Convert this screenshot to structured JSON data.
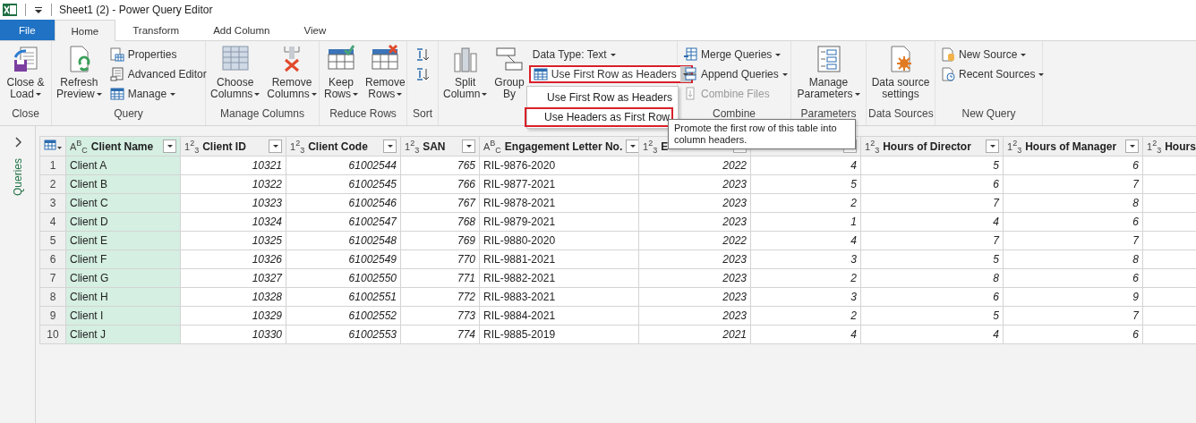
{
  "window": {
    "title": "Sheet1 (2) - Power Query Editor"
  },
  "tabs": [
    {
      "label": "File",
      "kind": "file",
      "selected": false
    },
    {
      "label": "Home",
      "kind": "tab",
      "selected": true
    },
    {
      "label": "Transform",
      "kind": "tab",
      "selected": false
    },
    {
      "label": "Add Column",
      "kind": "tab",
      "selected": false
    },
    {
      "label": "View",
      "kind": "tab",
      "selected": false
    }
  ],
  "ribbon": {
    "groups": [
      {
        "label": "Close",
        "items": [
          {
            "kind": "large",
            "lines": [
              "Close &",
              "Load"
            ],
            "dropdown": true
          }
        ]
      },
      {
        "label": "Query",
        "items": [
          {
            "kind": "large",
            "lines": [
              "Refresh",
              "Preview"
            ],
            "dropdown": true
          },
          {
            "kind": "stack",
            "items": [
              {
                "label": "Properties",
                "dropdown": false
              },
              {
                "label": "Advanced Editor",
                "dropdown": false
              },
              {
                "label": "Manage",
                "dropdown": true
              }
            ]
          }
        ]
      },
      {
        "label": "Manage Columns",
        "items": [
          {
            "kind": "large",
            "lines": [
              "Choose",
              "Columns"
            ],
            "dropdown": true
          },
          {
            "kind": "large",
            "lines": [
              "Remove",
              "Columns"
            ],
            "dropdown": true
          }
        ]
      },
      {
        "label": "Reduce Rows",
        "items": [
          {
            "kind": "large",
            "lines": [
              "Keep",
              "Rows"
            ],
            "dropdown": true
          },
          {
            "kind": "large",
            "lines": [
              "Remove",
              "Rows"
            ],
            "dropdown": true
          }
        ]
      },
      {
        "label": "Sort",
        "items": [
          {
            "kind": "icons",
            "items": [
              {
                "kind": "icon"
              },
              {
                "kind": "icon"
              }
            ]
          }
        ]
      },
      {
        "items": [
          {
            "kind": "large",
            "lines": [
              "Split",
              "Column"
            ],
            "dropdown": true
          },
          {
            "kind": "large",
            "lines": [
              "Group",
              "By"
            ],
            "dropdown": false
          },
          {
            "kind": "stack",
            "items": [
              {
                "label": "Data Type: Text",
                "dropdown": true
              },
              {
                "label": "Use First Row as Headers",
                "split": true,
                "highlighted": true
              }
            ]
          }
        ]
      },
      {
        "label": "Combine",
        "items": [
          {
            "kind": "stack",
            "items": [
              {
                "label": "Merge Queries",
                "dropdown": true
              },
              {
                "label": "Append Queries",
                "dropdown": true
              },
              {
                "label": "Combine Files",
                "disabled": true
              }
            ]
          }
        ]
      },
      {
        "label": "Parameters",
        "items": [
          {
            "kind": "large",
            "lines": [
              "Manage",
              "Parameters"
            ],
            "dropdown": true
          }
        ]
      },
      {
        "label": "Data Sources",
        "items": [
          {
            "kind": "large",
            "lines": [
              "Data source",
              "settings"
            ],
            "dropdown": false
          }
        ]
      },
      {
        "label": "New Query",
        "items": [
          {
            "kind": "stack",
            "items": [
              {
                "label": "New Source",
                "dropdown": true
              },
              {
                "label": "Recent Sources",
                "dropdown": true
              }
            ]
          }
        ]
      }
    ]
  },
  "dropdown_menu": {
    "items": [
      {
        "label": "Use First Row as Headers",
        "highlighted": false
      },
      {
        "label": "Use Headers as First Row",
        "highlighted": true
      }
    ]
  },
  "tooltip": {
    "text": "Promote the first row of this table into column headers."
  },
  "queries_pane": {
    "label": "Queries",
    "expanded": false
  },
  "table": {
    "columns": [
      {
        "type_label": "A$^{B}$$_{C}$",
        "label": "Client Name",
        "kind": "text",
        "selected": true,
        "filter": true
      },
      {
        "type_label": "1$^{2}$$_{3}$",
        "label": "Client ID",
        "kind": "number",
        "selected": false,
        "filter": true
      },
      {
        "type_label": "1$^{2}$$_{3}$",
        "label": "Client Code",
        "kind": "number",
        "selected": false,
        "filter": true
      },
      {
        "type_label": "1$^{2}$$_{3}$",
        "label": "SAN",
        "kind": "number",
        "selected": false,
        "filter": true
      },
      {
        "type_label": "A$^{B}$$_{C}$",
        "label": "Engagement Letter No.",
        "kind": "text",
        "selected": false,
        "filter": true
      },
      {
        "type_label": "1$^{2}$$_{3}$",
        "label": "E",
        "kind": "number",
        "selected": false,
        "filter": true
      },
      {
        "kind": "number",
        "selected": false,
        "filter": true
      },
      {
        "type_label": "1$^{2}$$_{3}$",
        "label": "Hours of Director",
        "kind": "number",
        "selected": false,
        "filter": true
      },
      {
        "type_label": "1$^{2}$$_{3}$",
        "label": "Hours of Manager",
        "kind": "number",
        "selected": false,
        "filter": true
      },
      {
        "type_label": "1$^{2}$$_{3}$",
        "label": "Hours",
        "selected": false
      }
    ],
    "rows": [
      {
        "number": "1",
        "cells": [
          "Client A",
          "10321",
          "61002544",
          "765",
          "RIL-9876-2020",
          "2022",
          "4",
          "5",
          "6"
        ]
      },
      {
        "number": "2",
        "cells": [
          "Client B",
          "10322",
          "61002545",
          "766",
          "RIL-9877-2021",
          "2023",
          "5",
          "6",
          "7"
        ]
      },
      {
        "number": "3",
        "cells": [
          "Client C",
          "10323",
          "61002546",
          "767",
          "RIL-9878-2021",
          "2023",
          "2",
          "7",
          "8"
        ]
      },
      {
        "number": "4",
        "cells": [
          "Client D",
          "10324",
          "61002547",
          "768",
          "RIL-9879-2021",
          "2023",
          "1",
          "4",
          "6"
        ]
      },
      {
        "number": "5",
        "cells": [
          "Client E",
          "10325",
          "61002548",
          "769",
          "RIL-9880-2020",
          "2022",
          "4",
          "7",
          "7"
        ]
      },
      {
        "number": "6",
        "cells": [
          "Client F",
          "10326",
          "61002549",
          "770",
          "RIL-9881-2021",
          "2023",
          "3",
          "5",
          "8"
        ]
      },
      {
        "number": "7",
        "cells": [
          "Client G",
          "10327",
          "61002550",
          "771",
          "RIL-9882-2021",
          "2023",
          "2",
          "8",
          "6"
        ]
      },
      {
        "number": "8",
        "cells": [
          "Client H",
          "10328",
          "61002551",
          "772",
          "RIL-9883-2021",
          "2023",
          "3",
          "6",
          "9"
        ]
      },
      {
        "number": "9",
        "cells": [
          "Client I",
          "10329",
          "61002552",
          "773",
          "RIL-9884-2021",
          "2023",
          "2",
          "5",
          "7"
        ]
      },
      {
        "number": "10",
        "cells": [
          "Client J",
          "10330",
          "61002553",
          "774",
          "RIL-9885-2019",
          "2021",
          "4",
          "4",
          "6"
        ]
      }
    ]
  }
}
